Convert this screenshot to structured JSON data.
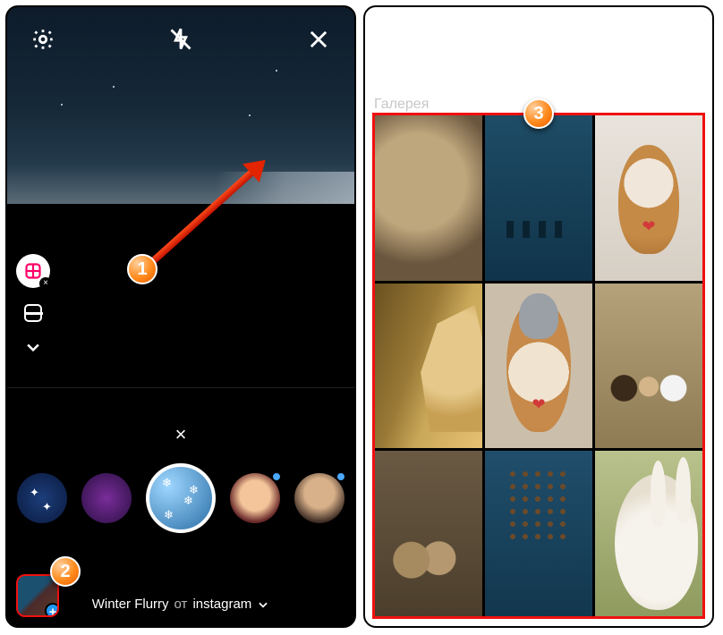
{
  "left": {
    "top_icons": {
      "settings": "settings",
      "flash": "flash-off",
      "close": "close"
    },
    "side_tools": {
      "layout": "layout-grid",
      "multi": "multi-capture",
      "expand": "expand-more"
    },
    "filters": {
      "close": "×",
      "items": [
        {
          "name": "sparkle-blue"
        },
        {
          "name": "nebula-purple"
        },
        {
          "name": "winter-flurry",
          "active": true
        },
        {
          "name": "face-mask",
          "badge": true
        },
        {
          "name": "portrait",
          "badge": true
        }
      ],
      "label_name": "Winter Flurry",
      "label_from": "от",
      "label_author": "instagram"
    },
    "gallery_button": {
      "plus": "+"
    }
  },
  "right": {
    "title": "Галерея",
    "grid": [
      "cat-closeup",
      "deer-lake",
      "shiba-heart",
      "golden-retriever",
      "dog-hat-heart",
      "three-dogs",
      "kittens",
      "deer-lake-branches",
      "white-rabbit"
    ]
  },
  "annotations": {
    "m1": "1",
    "m2": "2",
    "m3": "3"
  }
}
